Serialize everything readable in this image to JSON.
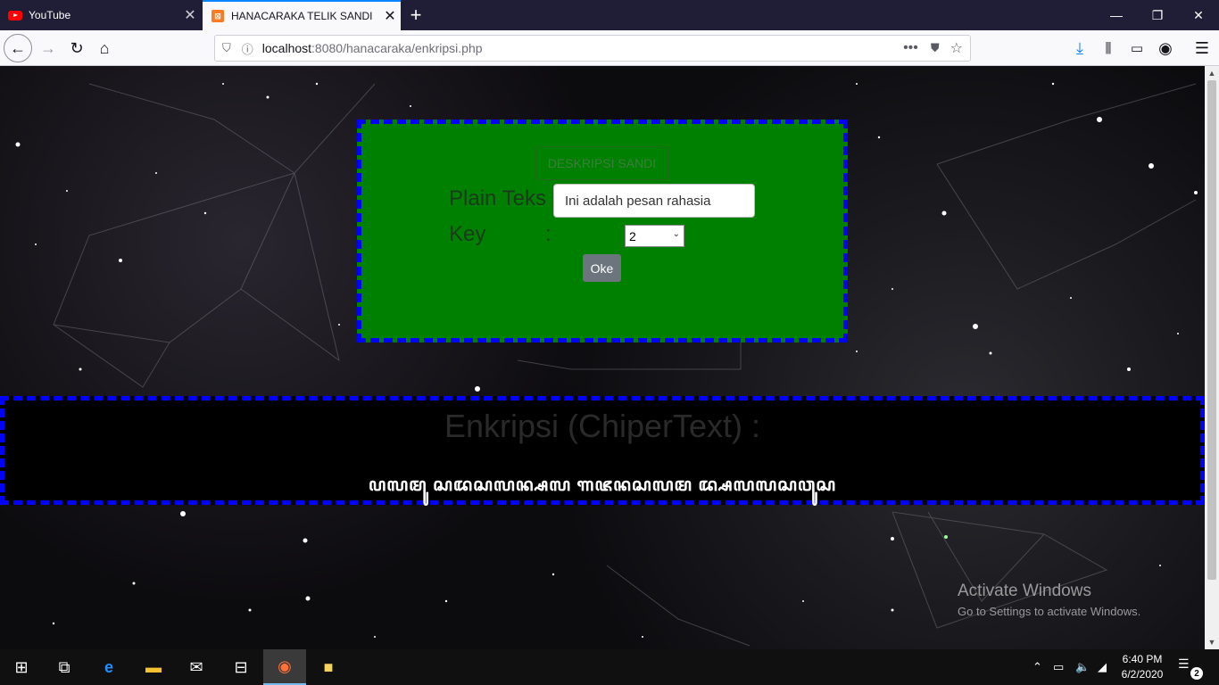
{
  "browser": {
    "tabs": [
      {
        "title": "YouTube",
        "icon": "youtube-icon",
        "active": false
      },
      {
        "title": "HANACARAKA TELIK SANDI",
        "icon": "xampp-icon",
        "active": true
      }
    ],
    "url_host": "localhost",
    "url_rest": ":8080/hanacaraka/enkripsi.php",
    "new_tab_glyph": "+",
    "tab_close_glyph": "✕"
  },
  "form": {
    "deskripsi_label": "DESKRIPSI SANDI",
    "plain_label": "Plain Teks :",
    "plain_value": "Ini adalah pesan rahasia",
    "key_label": "Key",
    "key_colon": ":",
    "key_value": "2",
    "submit_label": "Oke"
  },
  "result": {
    "title": "Enkripsi (ChiperText) :",
    "cipher": "ꦥꦭꦩꦸ ꦱꦢꦱꦭꦤ꧀ꦱꦭ ꦒꦗꦤꦱꦭꦩ ꦢ꧀ꦱꦭꦭꦱꦮꦸꦱ"
  },
  "watermark": {
    "line1": "Activate Windows",
    "line2": "Go to Settings to activate Windows."
  },
  "taskbar": {
    "time": "6:40 PM",
    "date": "6/2/2020",
    "notification_count": "2"
  },
  "colors": {
    "form_bg": "#008000",
    "dashed_border": "#0000ff",
    "button_gray": "#6c757d",
    "tab_accent": "#0a84ff"
  }
}
